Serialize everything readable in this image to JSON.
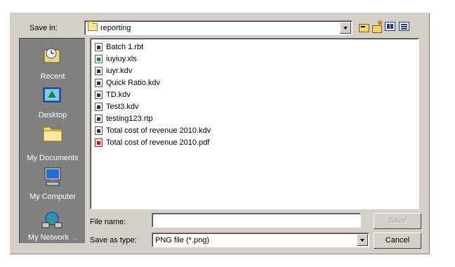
{
  "header": {
    "save_in_label": "Save in:",
    "current_folder": "reporting"
  },
  "toolbar": {
    "icons": [
      "up-one-level-icon",
      "new-folder-icon",
      "list-view-icon",
      "details-view-icon"
    ]
  },
  "places": [
    {
      "label": "Recent",
      "icon": "recent-icon"
    },
    {
      "label": "Desktop",
      "icon": "desktop-icon"
    },
    {
      "label": "My Documents",
      "icon": "my-documents-icon"
    },
    {
      "label": "My Computer",
      "icon": "my-computer-icon"
    },
    {
      "label": "My Network ...",
      "icon": "my-network-icon"
    }
  ],
  "files": [
    {
      "name": "Batch 1.rbt",
      "icon": "report-file-icon"
    },
    {
      "name": "iuyiuy.xls",
      "icon": "excel-file-icon"
    },
    {
      "name": "iuyr.kdv",
      "icon": "report-file-icon"
    },
    {
      "name": "Quick Ratio.kdv",
      "icon": "report-file-icon"
    },
    {
      "name": "TD.kdv",
      "icon": "report-file-icon"
    },
    {
      "name": "Test3.kdv",
      "icon": "report-file-icon"
    },
    {
      "name": "testing123.rtp",
      "icon": "report-file-icon"
    },
    {
      "name": "Total cost of revenue 2010.kdv",
      "icon": "report-file-icon"
    },
    {
      "name": "Total cost of revenue 2010.pdf",
      "icon": "pdf-file-icon"
    }
  ],
  "form": {
    "file_name_label": "File name:",
    "file_name_value": "",
    "save_as_type_label": "Save as type:",
    "save_as_type_value": "PNG file (*.png)",
    "save_button": "Save",
    "cancel_button": "Cancel"
  }
}
